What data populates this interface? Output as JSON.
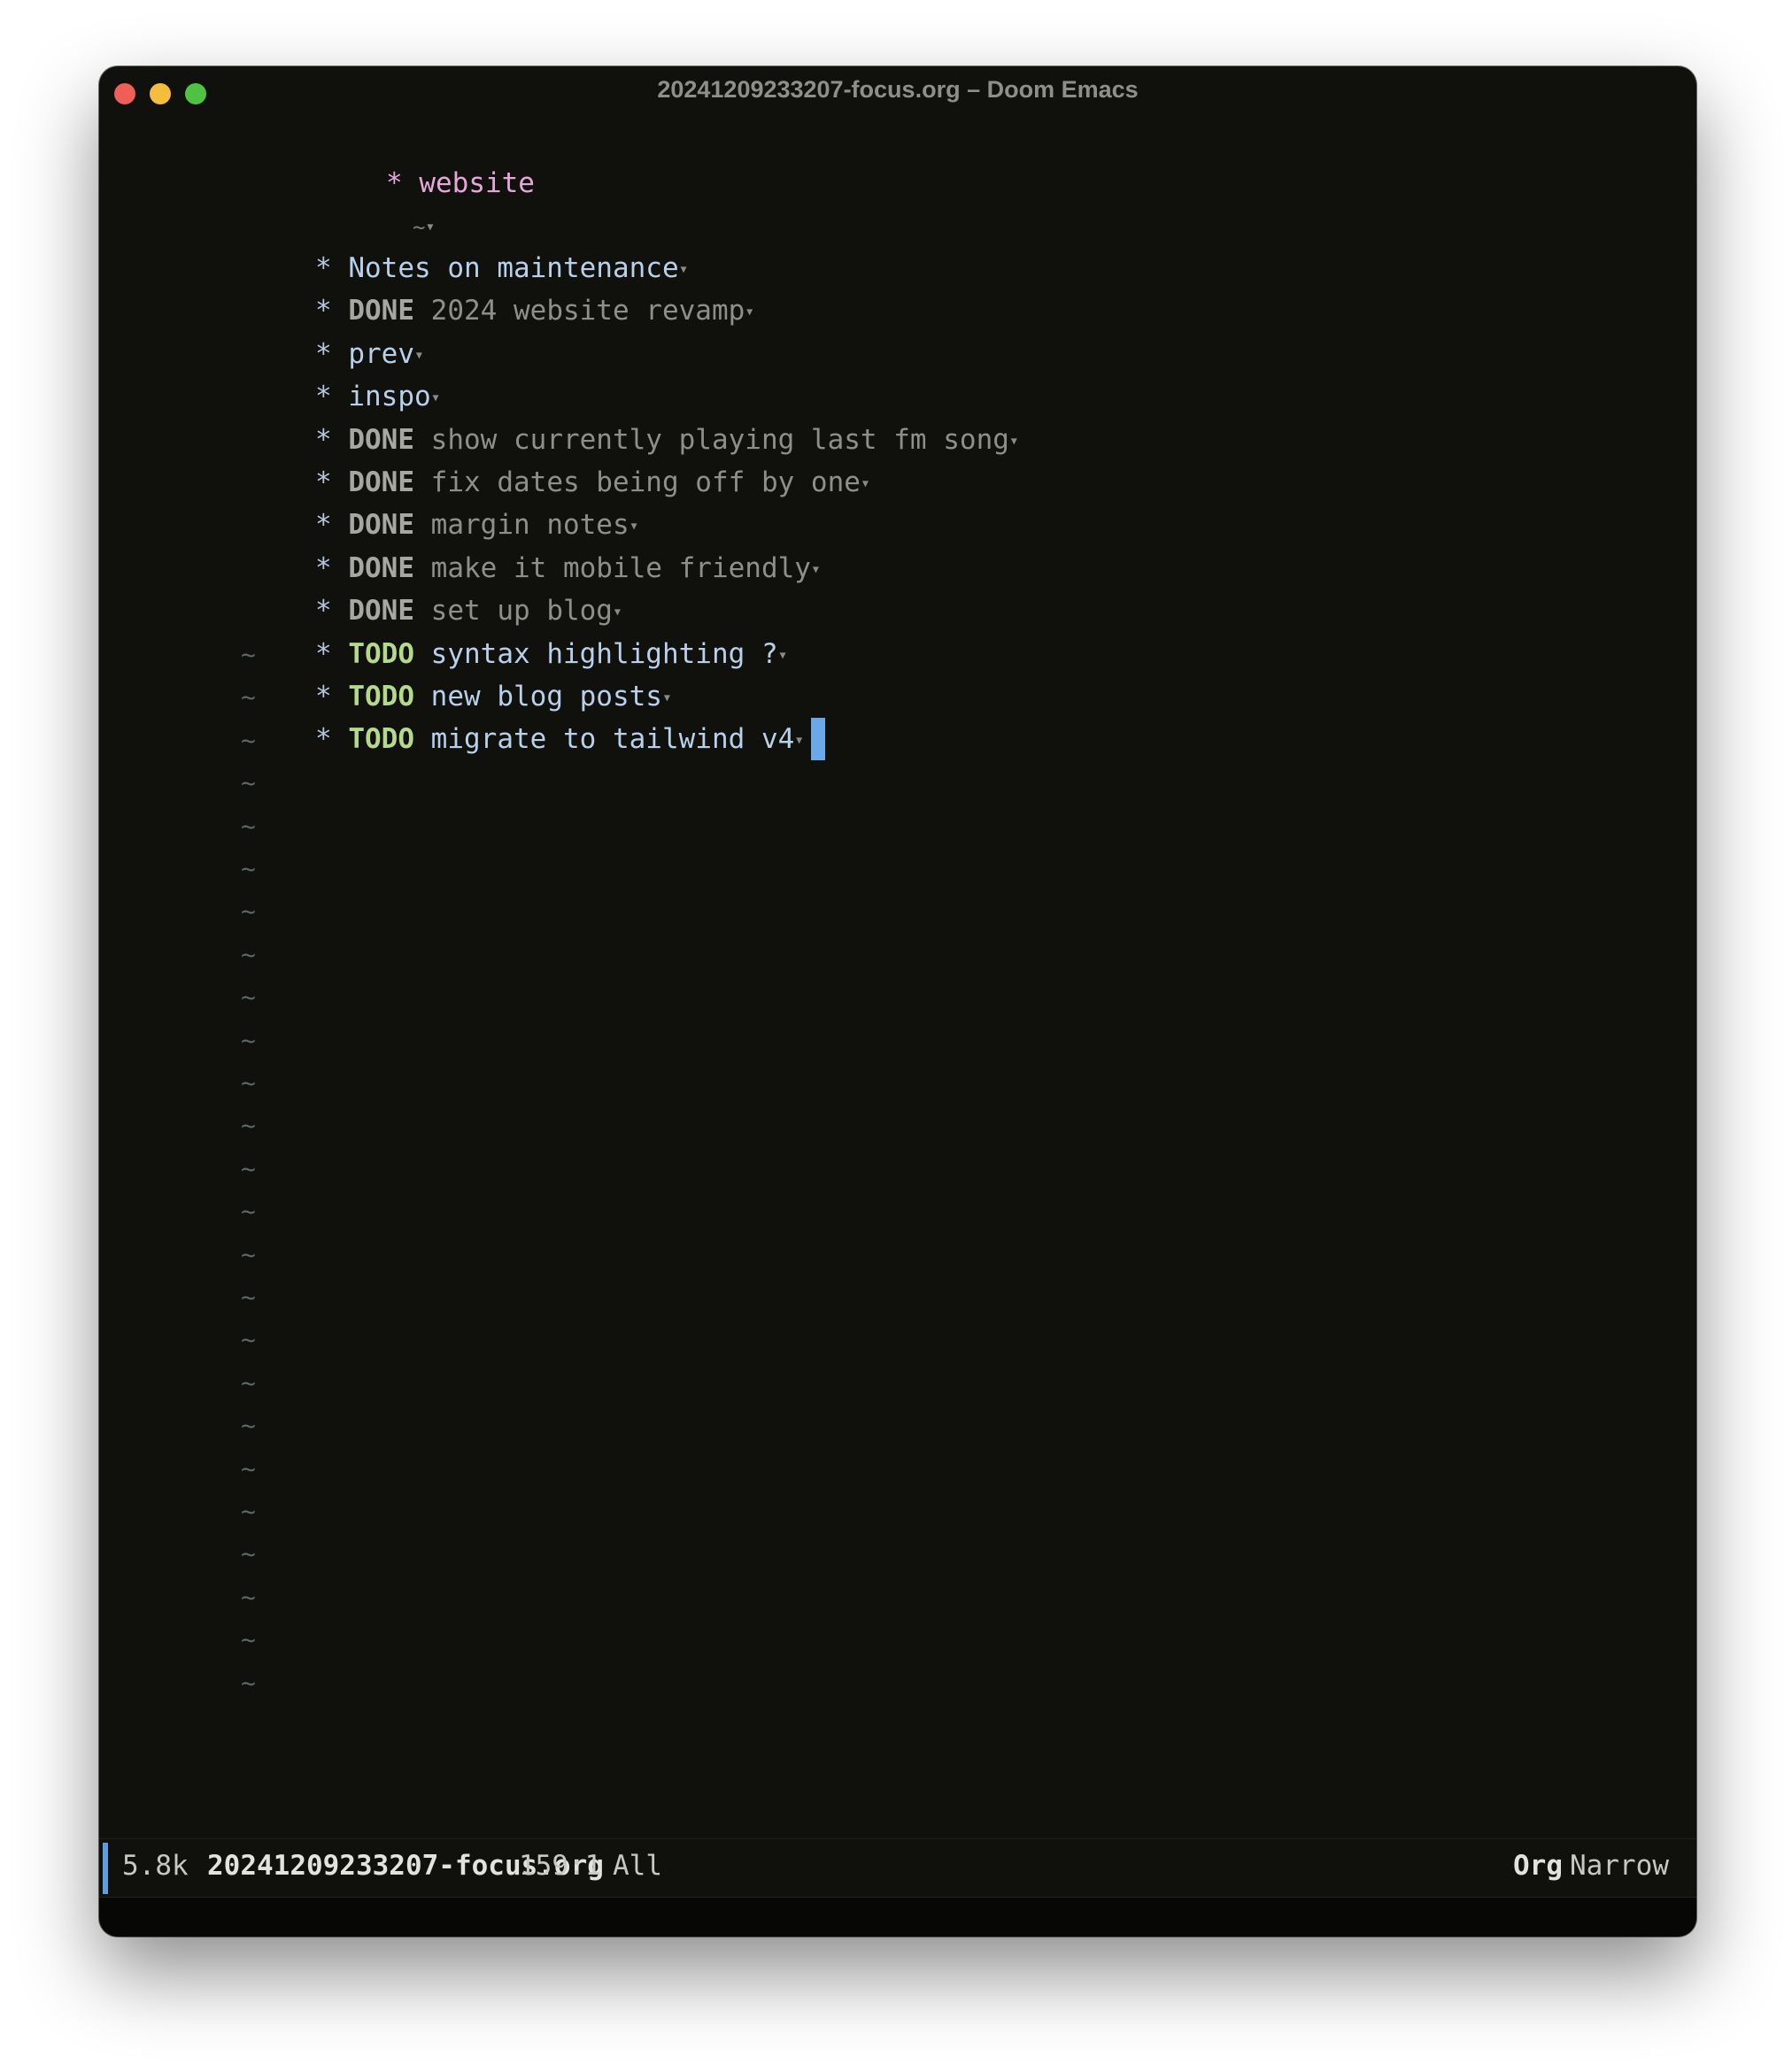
{
  "window": {
    "title": "20241209233207-focus.org – Doom Emacs",
    "traffic_lights": {
      "close_color": "#ed5f57",
      "minimize_color": "#f4bd3b",
      "maximize_color": "#4fc244"
    }
  },
  "buffer": {
    "top_heading": {
      "star": "*",
      "text": "website"
    },
    "drawer_line": "~",
    "headings": [
      {
        "star": "*",
        "keyword": "",
        "text": "Notes on maintenance"
      },
      {
        "star": "*",
        "keyword": "DONE",
        "text": "2024 website revamp"
      },
      {
        "star": "*",
        "keyword": "",
        "text": "prev"
      },
      {
        "star": "*",
        "keyword": "",
        "text": "inspo"
      },
      {
        "star": "*",
        "keyword": "DONE",
        "text": "show currently playing last fm song"
      },
      {
        "star": "*",
        "keyword": "DONE",
        "text": "fix dates being off by one"
      },
      {
        "star": "*",
        "keyword": "DONE",
        "text": "margin notes"
      },
      {
        "star": "*",
        "keyword": "DONE",
        "text": "make it mobile friendly"
      },
      {
        "star": "*",
        "keyword": "DONE",
        "text": "set up blog"
      },
      {
        "star": "*",
        "keyword": "TODO",
        "text": "syntax highlighting ?"
      },
      {
        "star": "*",
        "keyword": "TODO",
        "text": "new blog posts"
      },
      {
        "star": "*",
        "keyword": "TODO",
        "text": "migrate to tailwind v4"
      }
    ],
    "fold_indicator": "▾",
    "empty_line_marker": "~",
    "cursor_color": "#6aa8e8"
  },
  "modeline": {
    "size": "5.8k",
    "filename": "20241209233207-focus.org",
    "position": "159:1",
    "scroll": "All",
    "major_mode": "Org",
    "minor_mode": "Narrow",
    "accent_color": "#5aa0e0"
  }
}
